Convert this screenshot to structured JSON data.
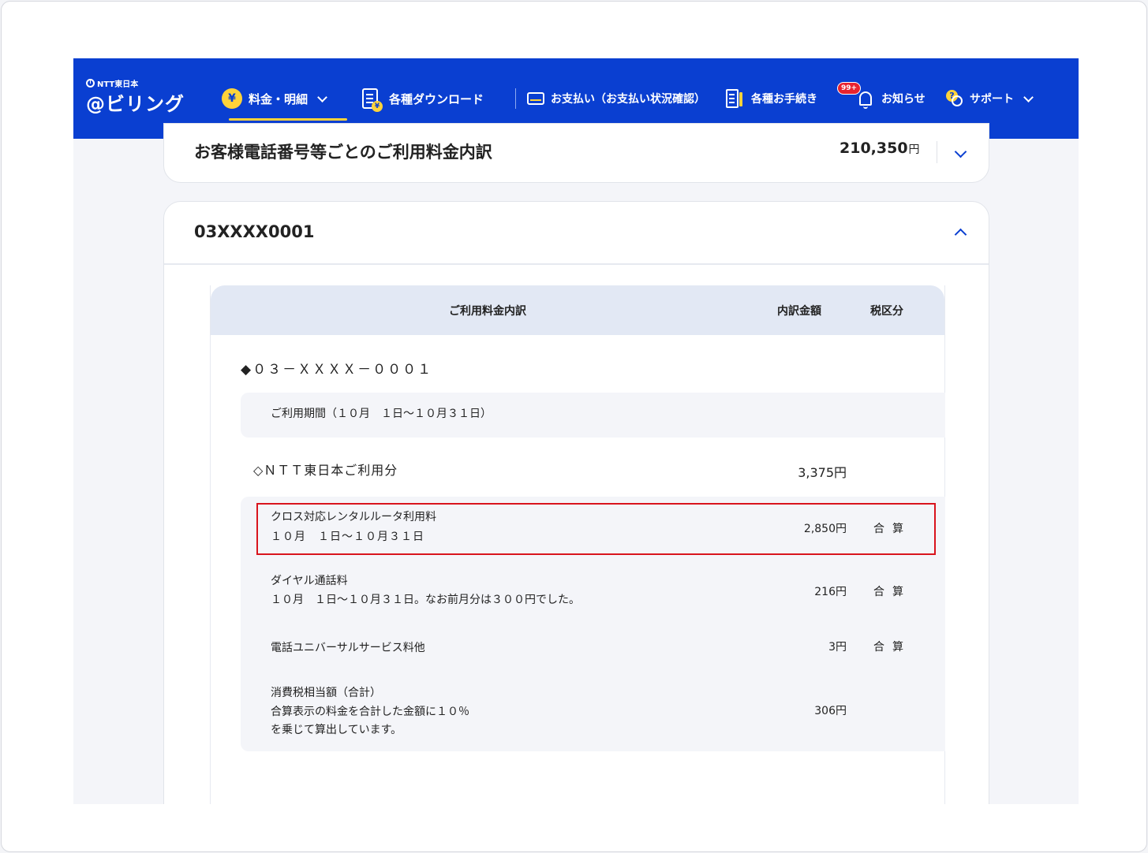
{
  "header": {
    "logo_small": "NTT東日本",
    "logo_main": "@ビリング",
    "nav": {
      "billing": "料金・明細",
      "downloads": "各種ダウンロード",
      "payment": "お支払い（お支払い状況確認）",
      "procedures": "各種お手続き",
      "notices": "お知らせ",
      "notices_badge": "99+",
      "support": "サポート"
    },
    "yen_glyph": "¥"
  },
  "summary": {
    "title": "お客様電話番号等ごとのご利用料金内訳",
    "amount": "210,350",
    "currency": "円"
  },
  "detail": {
    "title": "03XXXX0001",
    "columns": {
      "breakdown": "ご利用料金内訳",
      "amount": "内訳金額",
      "tax": "税区分"
    },
    "phone": "◆０３－ＸＸＸＸ－０００１",
    "period": "ご利用期間（１０月　１日～１０月３１日）",
    "service": {
      "label": "◇ＮＴＴ東日本ご利用分",
      "amount": "3,375円"
    },
    "items": [
      {
        "line1": "クロス対応レンタルルータ利用料",
        "line2": "１０月　１日～１０月３１日",
        "amount": "2,850円",
        "tax": "合算"
      },
      {
        "line1": "ダイヤル通話料",
        "line2": "１０月　１日～１０月３１日。なお前月分は３００円でした。",
        "amount": "216円",
        "tax": "合算"
      },
      {
        "line1": "電話ユニバーサルサービス料他",
        "amount": "3円",
        "tax": "合算"
      },
      {
        "line1": "消費税相当額（合計）",
        "line2": "合算表示の料金を合計した金額に１０％",
        "line3": "を乗じて算出しています。",
        "amount": "306円"
      }
    ]
  }
}
